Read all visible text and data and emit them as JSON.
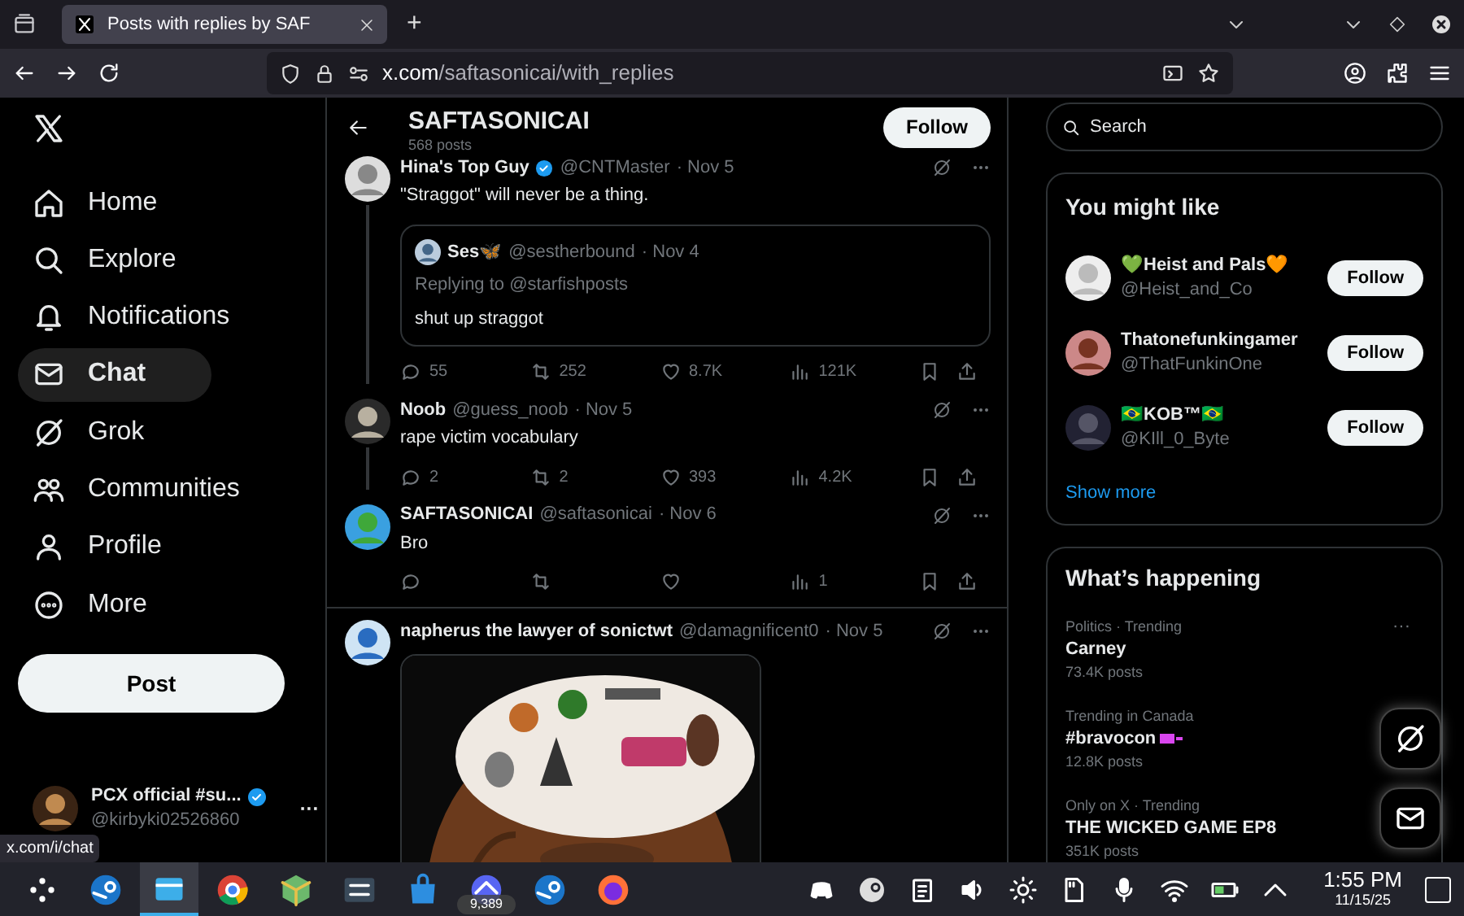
{
  "browser": {
    "tab": {
      "title": "Posts with replies by SAF",
      "selected": true
    },
    "url_host": "x.com",
    "url_path": "/saftasonicai/with_replies",
    "new_tab": "+"
  },
  "nav": {
    "items": [
      {
        "label": "Home",
        "selected": false
      },
      {
        "label": "Explore",
        "selected": false
      },
      {
        "label": "Notifications",
        "selected": false
      },
      {
        "label": "Chat",
        "selected": true
      },
      {
        "label": "Grok",
        "selected": false
      },
      {
        "label": "Communities",
        "selected": false
      },
      {
        "label": "Profile",
        "selected": false
      },
      {
        "label": "More",
        "selected": false
      }
    ],
    "post_button": "Post",
    "account": {
      "name": "PCX official #su...",
      "handle": "@kirbyki02526860",
      "verified": true,
      "menu": "···"
    }
  },
  "header": {
    "title": "SAFTASONICAI",
    "subtitle": "568 posts",
    "follow": "Follow"
  },
  "posts": [
    {
      "name": "Hina's Top Guy",
      "verified": true,
      "handle": "@CNTMaster",
      "date": "· Nov 5",
      "text": "\"Straggot\" will never be a thing.",
      "thread": true,
      "quote": {
        "name": "Ses🦋",
        "handle": "@sestherbound",
        "date": "· Nov 4",
        "replying": "Replying to @starfishposts",
        "text": "shut up straggot"
      },
      "replies": "55",
      "reposts": "252",
      "likes": "8.7K",
      "views": "121K"
    },
    {
      "name": "Noob",
      "verified": false,
      "handle": "@guess_noob",
      "date": "· Nov 5",
      "text": "rape victim vocabulary",
      "thread": true,
      "replies": "2",
      "reposts": "2",
      "likes": "393",
      "views": "4.2K"
    },
    {
      "name": "SAFTASONICAI",
      "verified": false,
      "handle": "@saftasonicai",
      "date": "· Nov 6",
      "text": "Bro",
      "thread": false,
      "views": "1"
    },
    {
      "name": "napherus the lawyer of sonictwt",
      "verified": false,
      "handle": "@damagnificent0",
      "date": "· Nov 5",
      "thread": false
    }
  ],
  "sidebar": {
    "search": {
      "placeholder": "Search"
    },
    "follow_card": {
      "title": "You might like",
      "users": [
        {
          "name": "💚Heist and Pals🧡",
          "handle": "@Heist_and_Co",
          "button": "Follow"
        },
        {
          "name": "Thatonefunkingamer",
          "handle": "@ThatFunkinOne",
          "button": "Follow"
        },
        {
          "name": "🇧🇷KOB™🇧🇷",
          "handle": "@KIll_0_Byte",
          "button": "Follow"
        }
      ],
      "show_more": "Show more"
    },
    "trends": {
      "title": "What’s happening",
      "items": [
        {
          "context": "Politics · Trending",
          "topic": "Carney",
          "count": "73.4K posts",
          "menu": "···"
        },
        {
          "context": "Trending in Canada",
          "topic": "#bravocon",
          "count": "12.8K posts",
          "hashflag": true
        },
        {
          "context": "Only on X · Trending",
          "topic": "THE WICKED GAME EP8",
          "count": "351K posts"
        }
      ]
    }
  },
  "status_link": "x.com/i/chat",
  "taskbar": {
    "apps": [
      {
        "selected": false
      },
      {
        "selected": false
      },
      {
        "selected": true
      },
      {
        "selected": false
      },
      {
        "selected": false
      },
      {
        "selected": false
      },
      {
        "selected": false
      },
      {
        "selected": false,
        "badge": "9,389"
      },
      {
        "selected": false
      },
      {
        "selected": false
      }
    ],
    "time": "1:55 PM",
    "date": "11/15/25"
  }
}
